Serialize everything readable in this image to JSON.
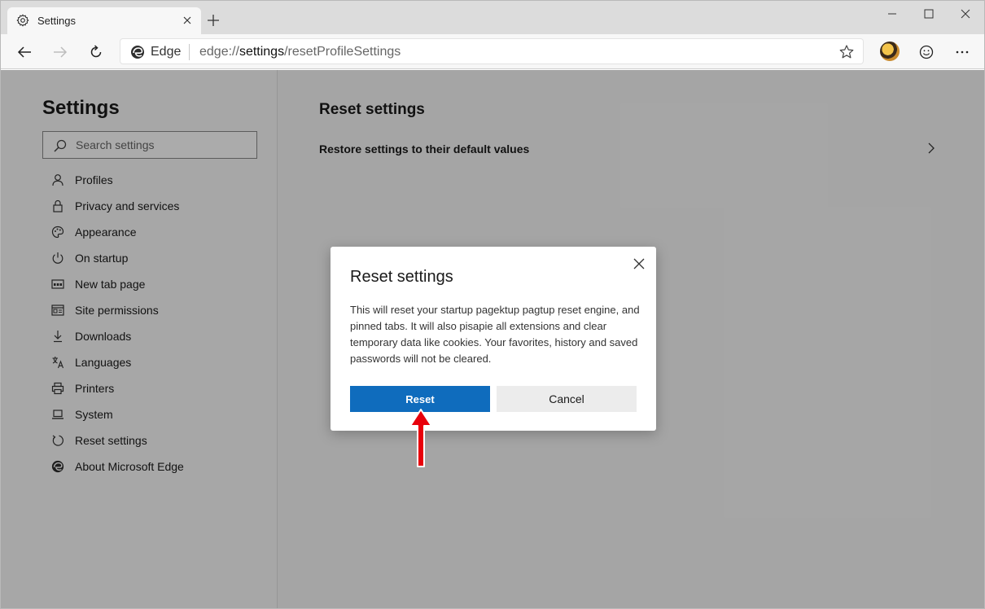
{
  "tab": {
    "title": "Settings",
    "icon": "gear-icon"
  },
  "address": {
    "brand": "Edge",
    "url_prefix": "edge://",
    "url_host": "settings",
    "url_path": "/resetProfileSettings"
  },
  "sidebar": {
    "title": "Settings",
    "search_placeholder": "Search settings",
    "items": [
      {
        "label": "Profiles",
        "icon": "person-icon"
      },
      {
        "label": "Privacy and services",
        "icon": "lock-icon"
      },
      {
        "label": "Appearance",
        "icon": "palette-icon"
      },
      {
        "label": "On startup",
        "icon": "power-icon"
      },
      {
        "label": "New tab page",
        "icon": "newtab-grid-icon"
      },
      {
        "label": "Site permissions",
        "icon": "site-permissions-icon"
      },
      {
        "label": "Downloads",
        "icon": "download-icon"
      },
      {
        "label": "Languages",
        "icon": "languages-icon"
      },
      {
        "label": "Printers",
        "icon": "printer-icon"
      },
      {
        "label": "System",
        "icon": "laptop-icon"
      },
      {
        "label": "Reset settings",
        "icon": "reset-icon"
      },
      {
        "label": "About Microsoft Edge",
        "icon": "edge-logo-icon"
      }
    ]
  },
  "main": {
    "title": "Reset settings",
    "restore_label": "Restore settings to their default values"
  },
  "dialog": {
    "title": "Reset settings",
    "body": "This will reset your startup pagektup pagtup ŗeset engine, and pinned tabs. It will also pisapie all extensions and clear temporary data like cookies. Your favorites, history and saved passwords will not be cleared.",
    "reset_label": "Reset",
    "cancel_label": "Cancel"
  },
  "colors": {
    "accent": "#0f6cbd",
    "annotation_arrow": "#e8000b"
  }
}
